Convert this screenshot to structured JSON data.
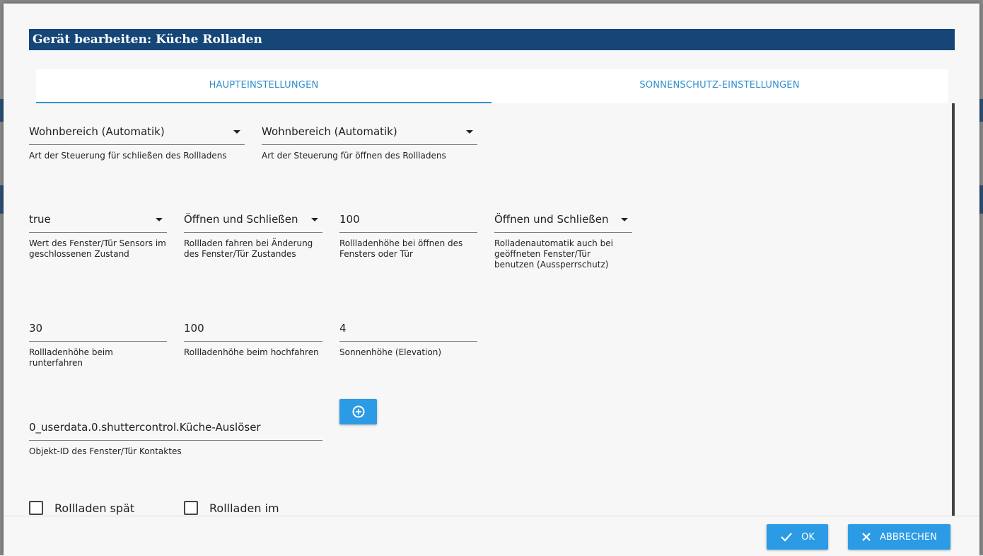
{
  "dialog": {
    "title": "Gerät bearbeiten: Küche Rolladen"
  },
  "tabs": [
    {
      "label": "HAUPTEINSTELLUNGEN",
      "active": true
    },
    {
      "label": "SONNENSCHUTZ-EINSTELLUNGEN",
      "active": false
    }
  ],
  "fields": {
    "close_control": {
      "value": "Wohnbereich (Automatik)",
      "helper": "Art der Steuerung für schließen des Rollladens"
    },
    "open_control": {
      "value": "Wohnbereich (Automatik)",
      "helper": "Art der Steuerung für öffnen des Rollladens"
    },
    "sensor_closed_value": {
      "value": "true",
      "helper": "Wert des Fenster/Tür Sensors im geschlossenen Zustand"
    },
    "move_on_change": {
      "value": "Öffnen und Schließen",
      "helper": "Rollladen fahren bei Änderung des Fenster/Tür Zustandes"
    },
    "height_on_open": {
      "value": "100",
      "helper": "Rollladenhöhe bei öffnen des Fensters oder Tür"
    },
    "lockout_protection": {
      "value": "Öffnen und Schließen",
      "helper": "Rolladenautomatik auch bei geöffneten Fenster/Tür benutzen (Aussperrschutz)"
    },
    "height_down": {
      "value": "30",
      "helper": "Rollladenhöhe beim runterfahren"
    },
    "height_up": {
      "value": "100",
      "helper": "Rollladenhöhe beim hochfahren"
    },
    "sun_elevation": {
      "value": "4",
      "helper": "Sonnenhöhe (Elevation)"
    },
    "contact_object_id": {
      "value": "0_userdata.0.shuttercontrol.Küche-Auslöser",
      "helper": "Objekt-ID des Fenster/Tür Kontaktes"
    }
  },
  "checkboxes": {
    "late": {
      "label": "Rollladen spät",
      "checked": false
    },
    "in": {
      "label": "Rollladen im",
      "checked": false
    }
  },
  "footer": {
    "ok_label": "OK",
    "cancel_label": "ABBRECHEN"
  },
  "colors": {
    "title_bg": "#154677",
    "accent": "#2c9be6",
    "tab_text": "#2f8fce"
  },
  "icons": {
    "add": "add-circle-icon",
    "ok": "check-icon",
    "cancel": "close-icon",
    "dropdown": "chevron-down-icon"
  }
}
